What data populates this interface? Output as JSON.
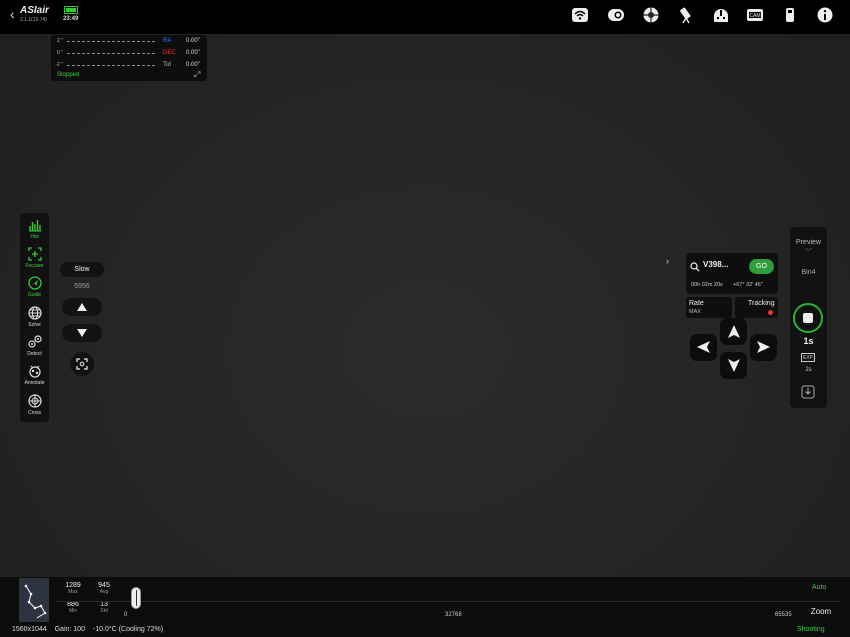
{
  "top_bar": {
    "app_name": "ASIair",
    "version": "2.1.1(10.74)",
    "time": "23:49",
    "icons": [
      "back-icon",
      "battery-icon",
      "wifi-icon",
      "mount-icon",
      "filter-wheel-icon",
      "telescope-icon",
      "observatory-icon",
      "camera-icon",
      "storage-icon",
      "info-icon"
    ]
  },
  "guide_graph": {
    "y_axis": [
      "2 \"",
      "0 \"",
      "-2 \""
    ],
    "rows": [
      {
        "name": "RA",
        "value": "0.00\"",
        "color": "#3b7bff"
      },
      {
        "name": "DEC",
        "value": "0.00\"",
        "color": "#e33b2e"
      },
      {
        "name": "Tot",
        "value": "0.00\"",
        "color": "#bbbbbb"
      }
    ],
    "status": "Stopped"
  },
  "left_panel": {
    "items": [
      {
        "label": "Hist",
        "icon": "histogram-icon",
        "active": true
      },
      {
        "label": "Focuser",
        "icon": "focuser-icon",
        "active": true
      },
      {
        "label": "Guide",
        "icon": "guide-icon",
        "active": true
      },
      {
        "label": "Solve",
        "icon": "solve-icon",
        "active": false
      },
      {
        "label": "Detect",
        "icon": "detect-icon",
        "active": false
      },
      {
        "label": "Annotate",
        "icon": "annotate-icon",
        "active": false
      },
      {
        "label": "Cross",
        "icon": "crosshair-icon",
        "active": false
      }
    ]
  },
  "focuser": {
    "speed": "Slow",
    "position": "5956"
  },
  "mount": {
    "target": "V398...",
    "go_label": "GO",
    "time_to_target": "00h 02m 20s",
    "dec": "+67° 32' 46\"",
    "rate_label": "Rate",
    "rate_value": "MAX",
    "tracking_label": "Tracking",
    "tracking_on": true
  },
  "capture": {
    "mode": "Preview",
    "bin": "Bin4",
    "exposure": "1s",
    "exp_label": "EXP",
    "interval": "2s"
  },
  "histogram": {
    "max_value": "1289",
    "max_label": "Max",
    "avg_value": "945",
    "avg_label": "Avg",
    "min_value": "886",
    "min_label": "Min",
    "std_value": "13",
    "std_label": "Std",
    "scale_min": "0",
    "scale_mid": "32768",
    "scale_max": "65535",
    "auto_label": "Auto",
    "zoom_label": "Zoom"
  },
  "status_bar": {
    "resolution": "1560x1044",
    "gain": "Gain: 100",
    "temperature": "-10.0°C (Cooling 72%)",
    "state": "Shooting"
  },
  "colors": {
    "accent_green": "#2e9e3a",
    "ra": "#3b7bff",
    "dec": "#e33b2e",
    "tracking_dot": "#e33333"
  }
}
